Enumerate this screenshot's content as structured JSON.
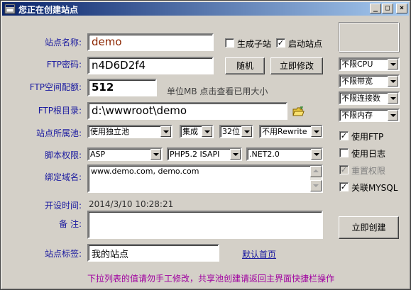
{
  "window": {
    "title": "您正在创建站点"
  },
  "titlebar_buttons": {
    "minimize": "_",
    "maximize": "□",
    "close": "×"
  },
  "labels": {
    "site_name": "站点名称:",
    "ftp_password": "FTP密码:",
    "ftp_quota": "FTP空间配额:",
    "ftp_root": "FTP根目录:",
    "site_pool": "站点所属池:",
    "script_perm": "脚本权限:",
    "bind_domain": "绑定域名:",
    "open_time": "开设时间:",
    "remark": "备 注:",
    "site_tag": "站点标签:"
  },
  "fields": {
    "site_name": "demo",
    "ftp_password": "n4D6D2f4",
    "ftp_quota": "512",
    "ftp_quota_hint": "单位MB 点击查看已用大小",
    "ftp_root": "d:\\wwwroot\\demo",
    "domains": "www.demo.com, demo.com",
    "open_time": "2014/3/10 10:28:21",
    "remark": "",
    "site_tag": "我的站点"
  },
  "checkboxes": {
    "gen_subsite": {
      "label": "生成子站",
      "checked": false
    },
    "start_site": {
      "label": "启动站点",
      "checked": true
    },
    "use_ftp": {
      "label": "使用FTP",
      "checked": true
    },
    "use_log": {
      "label": "使用日志",
      "checked": false
    },
    "reset_perm": {
      "label": "重置权限",
      "checked": true,
      "disabled": true
    },
    "link_mysql": {
      "label": "关联MYSQL",
      "checked": true
    }
  },
  "buttons": {
    "random": "随机",
    "modify_now": "立即修改",
    "create_now": "立即创建"
  },
  "selects": {
    "pool": "使用独立池",
    "pool_mode": "集成",
    "bitness": "32位",
    "rewrite": "不用Rewrite",
    "script_lang": "ASP",
    "php_version": "PHP5.2 ISAPI",
    "dotnet_version": ".NET2.0",
    "cpu_limit": "不限CPU",
    "bandwidth_limit": "不限带宽",
    "conn_limit": "不限连接数",
    "mem_limit": "不限内存"
  },
  "links": {
    "default_page": "默认首页"
  },
  "hint": "下拉列表的值请勿手工修改，共享池创建请返回主界面快捷栏操作",
  "colors": {
    "label": "#1a1aa0",
    "hint": "#a000a0",
    "site_name_text": "#8b2500",
    "titlebar_start": "#0a246a",
    "titlebar_end": "#a6caf0"
  }
}
